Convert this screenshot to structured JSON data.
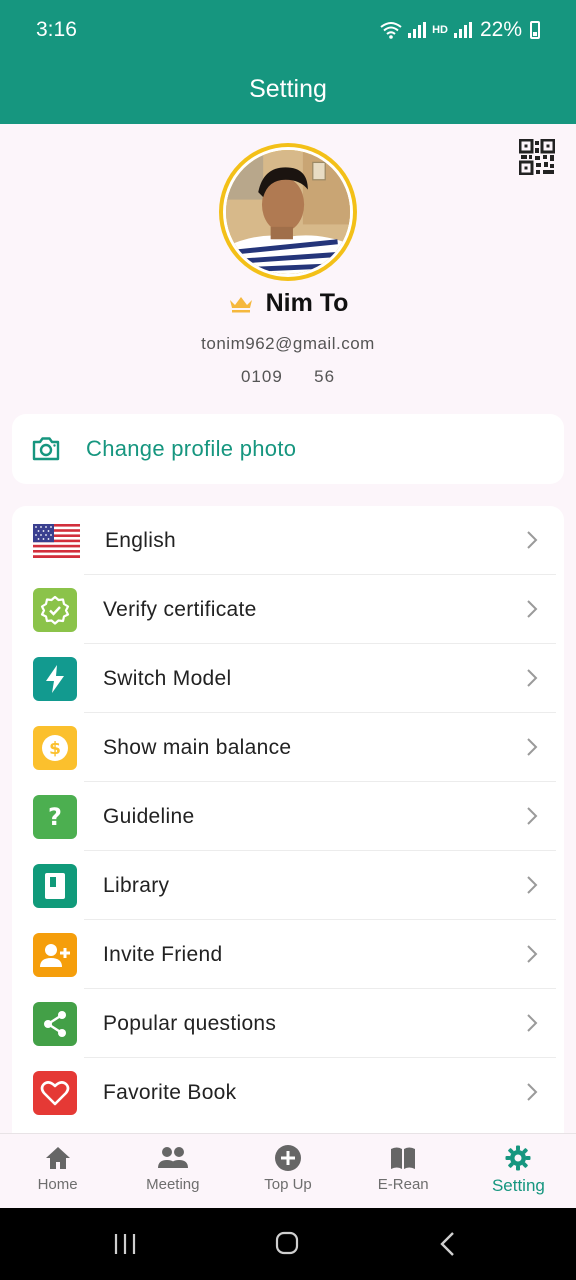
{
  "status_bar": {
    "time": "3:16",
    "network": "HD",
    "battery": "22%"
  },
  "app_bar": {
    "title": "Setting"
  },
  "profile": {
    "name": "Nim To",
    "email": "tonim962@gmail.com",
    "phone": "0109   56"
  },
  "change_photo": {
    "label": "Change profile photo"
  },
  "menu": [
    {
      "label": "English",
      "icon": "us-flag-icon",
      "color": ""
    },
    {
      "label": "Verify certificate",
      "icon": "verified-badge-icon",
      "color": "#8bc34a"
    },
    {
      "label": "Switch Model",
      "icon": "lightning-icon",
      "color": "#129a8f"
    },
    {
      "label": "Show main balance",
      "icon": "dollar-coin-icon",
      "color": "#fbc02d"
    },
    {
      "label": "Guideline",
      "icon": "question-icon",
      "color": "#4caf50"
    },
    {
      "label": "Library",
      "icon": "book-icon",
      "color": "#109a7a"
    },
    {
      "label": "Invite Friend",
      "icon": "add-person-icon",
      "color": "#f59e0b"
    },
    {
      "label": "Popular questions",
      "icon": "share-icon",
      "color": "#43a047"
    },
    {
      "label": "Favorite Book",
      "icon": "heart-icon",
      "color": "#e53935"
    }
  ],
  "bottom_nav": [
    {
      "label": "Home",
      "icon": "home-icon"
    },
    {
      "label": "Meeting",
      "icon": "group-icon"
    },
    {
      "label": "Top Up",
      "icon": "plus-circle-icon"
    },
    {
      "label": "E-Rean",
      "icon": "open-book-icon"
    },
    {
      "label": "Setting",
      "icon": "gear-icon",
      "active": true
    }
  ],
  "colors": {
    "primary": "#16967f",
    "crown": "#f5b83d",
    "avatar_ring": "#f3c018"
  }
}
